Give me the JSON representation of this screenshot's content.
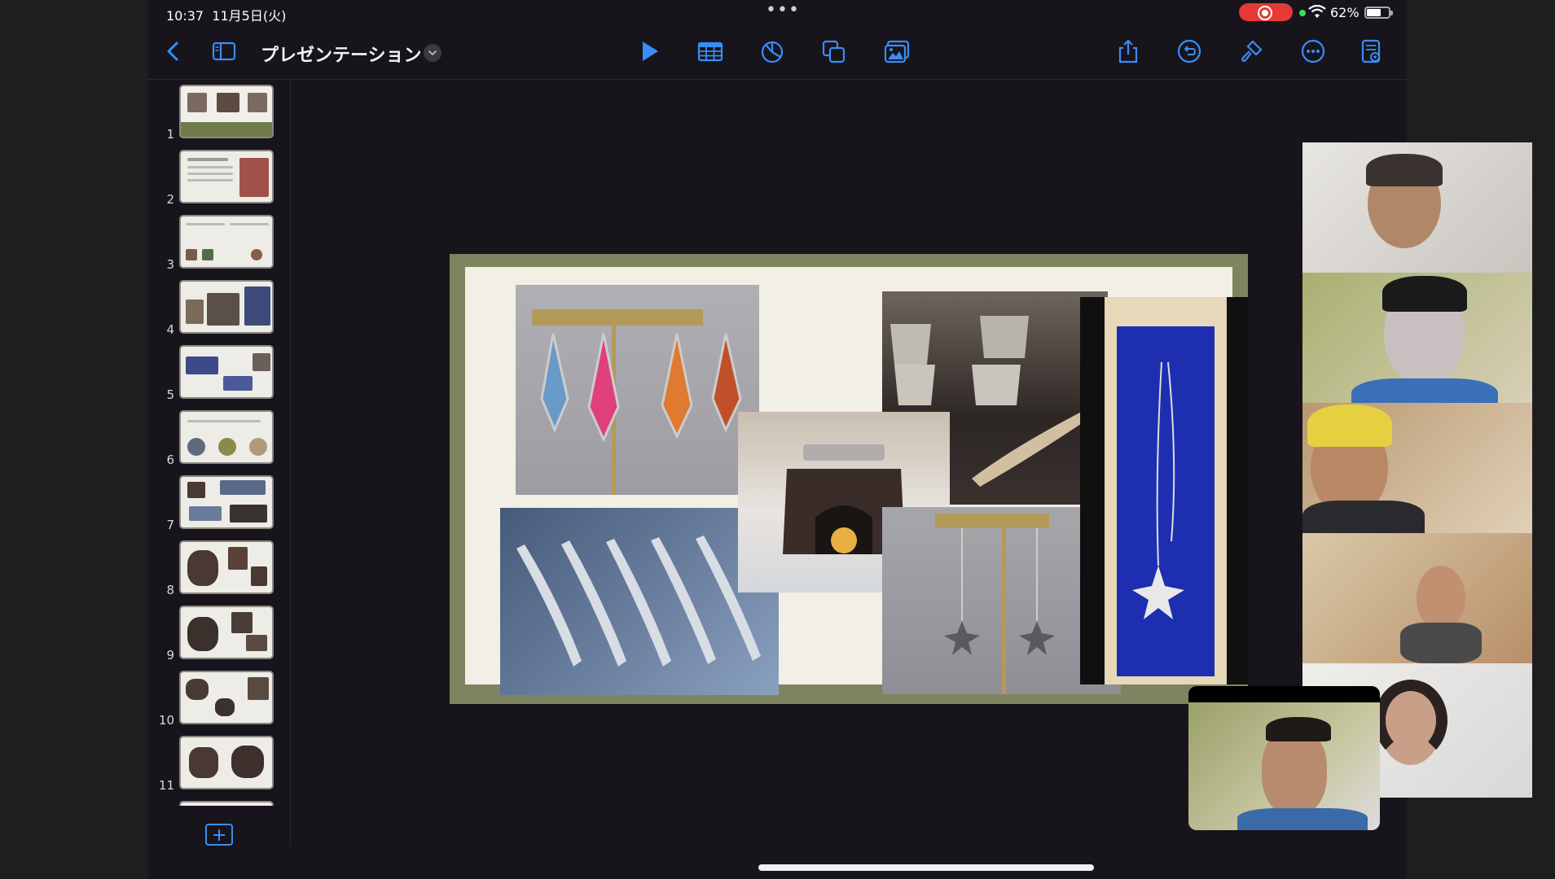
{
  "status_bar": {
    "time": "10:37",
    "date": "11月5日(火)",
    "battery_percent": "62%",
    "recording_color": "#e53935"
  },
  "toolbar": {
    "title": "プレゼンテーション",
    "left_icons": [
      "back-chevron-icon",
      "sidebar-icon"
    ],
    "center_icons": [
      "play-icon",
      "table-icon",
      "chart-icon",
      "shapes-icon",
      "media-icon"
    ],
    "right_icons": [
      "share-icon",
      "undo-icon",
      "format-brush-icon",
      "more-icon",
      "document-viewer-icon"
    ],
    "accent_color": "#3a8df5"
  },
  "slides": {
    "numbers": [
      "1",
      "2",
      "3",
      "4",
      "5",
      "6",
      "7",
      "8",
      "9",
      "10",
      "11"
    ],
    "count_visible": 11
  },
  "slide_canvas": {
    "images": [
      "earrings",
      "knives",
      "teacups",
      "burner",
      "star-earrings",
      "necklace"
    ]
  },
  "video_call": {
    "participants": 5,
    "self_view": true
  }
}
